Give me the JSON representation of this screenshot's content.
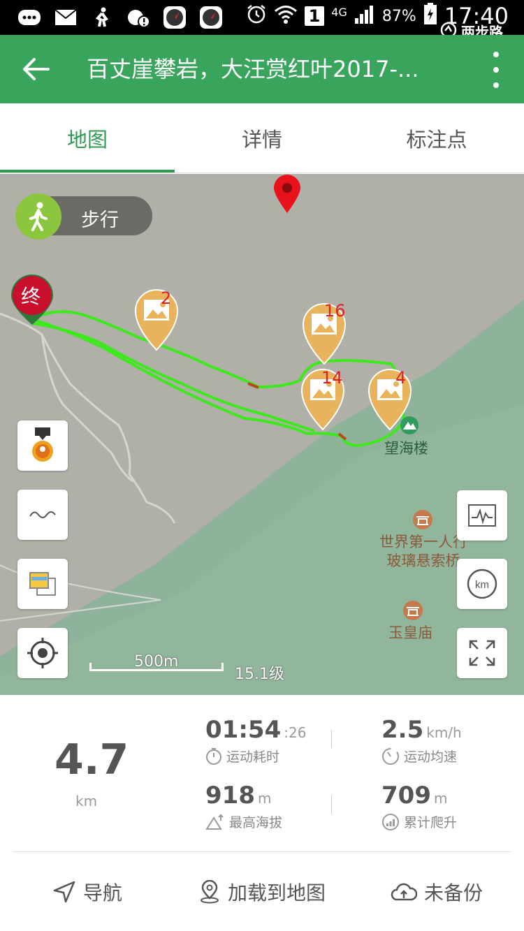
{
  "status_bar": {
    "network": "4G",
    "sim_slot": "1",
    "battery": "87%",
    "time": "17:40",
    "watermark": "两步路"
  },
  "app_bar": {
    "title": "百丈崖攀岩，大汪赏红叶2017-..."
  },
  "tabs": [
    {
      "label": "地图",
      "active": true
    },
    {
      "label": "详情",
      "active": false
    },
    {
      "label": "标注点",
      "active": false
    }
  ],
  "map": {
    "mode": "步行",
    "end_marker": "终",
    "photo_markers": [
      "2",
      "16",
      "14",
      "4"
    ],
    "poi": {
      "wanghailou": "望海楼",
      "bridge_line1": "世界第一人行",
      "bridge_line2": "玻璃悬索桥",
      "temple": "玉皇庙"
    },
    "scale": "500m",
    "zoom": "15.1级",
    "colors": {
      "track": "#3de81d",
      "accent": "#38a45c",
      "pin": "#e8b35c",
      "end_marker": "#c8102e"
    }
  },
  "stats": {
    "distance": {
      "value": "4.7",
      "unit": "km"
    },
    "duration": {
      "value": "01:54",
      "suffix": ":26",
      "label": "运动耗时"
    },
    "avg_speed": {
      "value": "2.5",
      "unit": "km/h",
      "label": "运动均速"
    },
    "max_altitude": {
      "value": "918",
      "unit": "m",
      "label": "最高海拔"
    },
    "total_climb": {
      "value": "709",
      "unit": "m",
      "label": "累计爬升"
    }
  },
  "actions": {
    "navigate": "导航",
    "load_to_map": "加载到地图",
    "backup": "未备份"
  }
}
